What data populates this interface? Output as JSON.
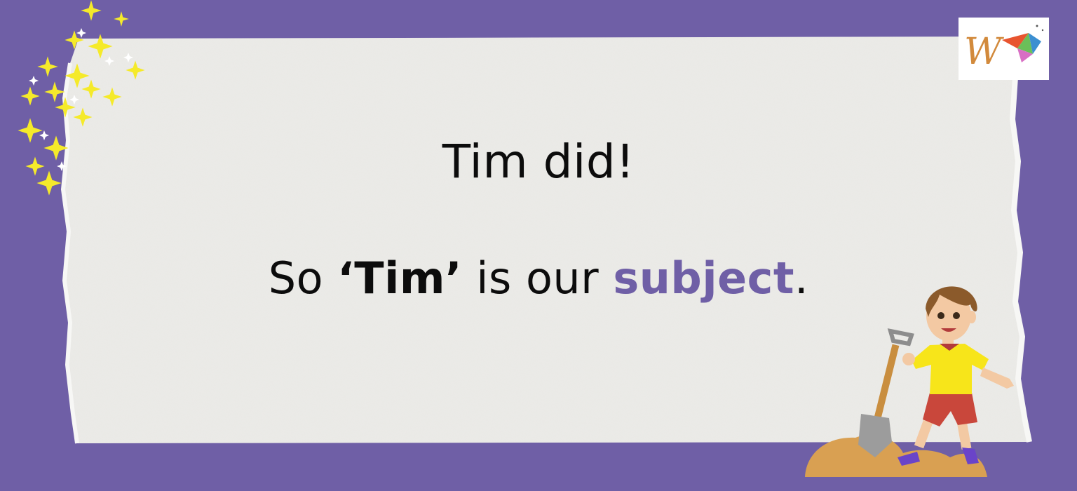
{
  "slide": {
    "line1": "Tim did!",
    "line2_prefix": "So ",
    "line2_emphasis": "‘Tim’",
    "line2_middle": " is our ",
    "line2_keyword": "subject",
    "line2_suffix": "."
  },
  "colors": {
    "background": "#6f5fa6",
    "paper": "#ecebe8",
    "keyword": "#6f5fa6",
    "text": "#0c0c0c"
  },
  "icons": [
    "sparkles-icon",
    "logo-icon",
    "boy-with-shovel-illustration"
  ]
}
